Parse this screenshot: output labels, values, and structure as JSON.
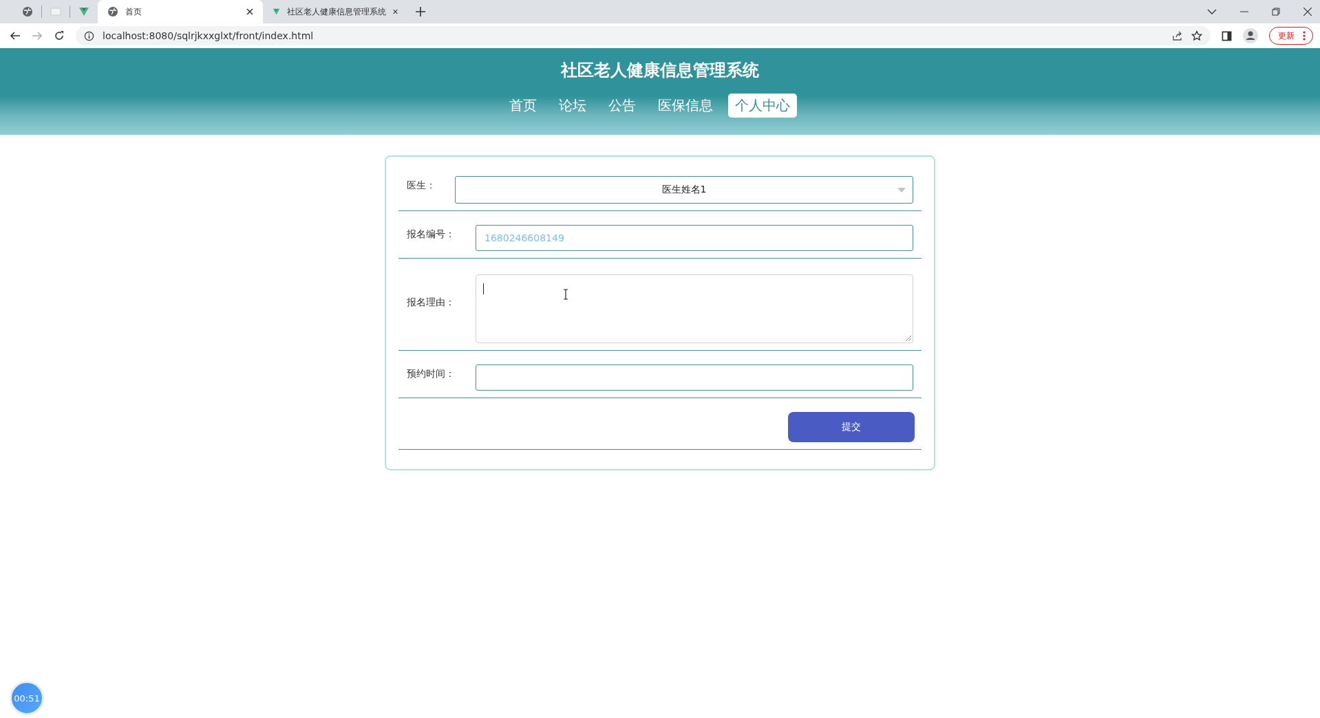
{
  "browser": {
    "tabs": [
      {
        "title": "首页",
        "selected": true
      },
      {
        "title": "社区老人健康信息管理系统",
        "selected": false
      }
    ],
    "address": "localhost:8080/sqlrjkxxglxt/front/index.html",
    "update_button": "更新"
  },
  "header": {
    "title": "社区老人健康信息管理系统"
  },
  "nav": [
    {
      "label": "首页",
      "selected": false
    },
    {
      "label": "论坛",
      "selected": false
    },
    {
      "label": "公告",
      "selected": false
    },
    {
      "label": "医保信息",
      "selected": false
    },
    {
      "label": "个人中心",
      "selected": true
    }
  ],
  "form": {
    "fields": [
      {
        "kind": "select",
        "label": "医生：",
        "value": "医生姓名1"
      },
      {
        "kind": "text",
        "label": "报名编号：",
        "value": "1680246608149"
      },
      {
        "kind": "textarea",
        "label": "报名理由："
      },
      {
        "kind": "text",
        "label": "预约时间："
      }
    ],
    "submit": "提交"
  },
  "timer": "00:51"
}
